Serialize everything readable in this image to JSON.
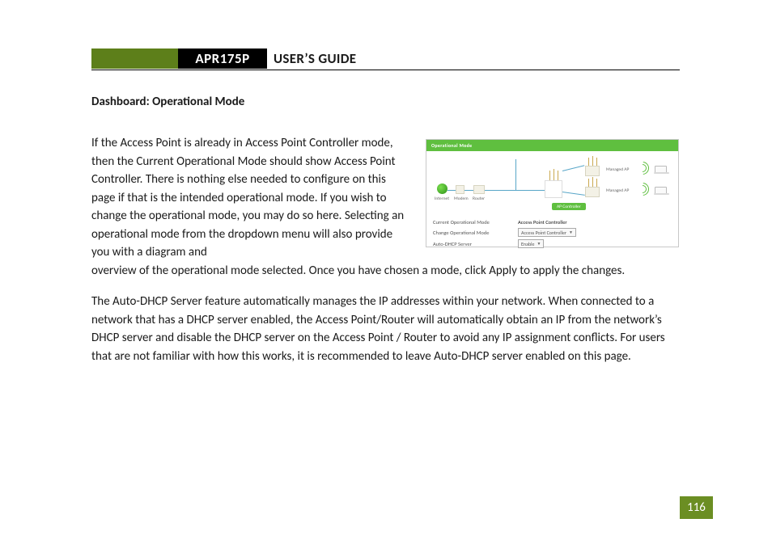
{
  "header": {
    "model": "APR175P",
    "title": "USER’S GUIDE"
  },
  "section_heading": "Dashboard: Operational Mode",
  "para1": "If the Access Point is already in Access Point Controller mode, then the Current Operational Mode should show Access Point Controller.  There is nothing else needed to configure on this page if that is the intended operational mode.  If you wish to change the operational mode, you may do so here.  Selecting an operational mode from the dropdown menu will also provide you with a diagram and",
  "para1_cont": "overview of the operational mode selected.  Once you have chosen a mode, click Apply to apply the changes.",
  "para2": "The Auto-DHCP Server feature automatically manages the IP addresses within your network.  When connected to a network that has a DHCP server enabled, the Access Point/Router will automatically obtain an IP from the network’s DHCP server and disable the DHCP server on the Access Point / Router to avoid any IP assignment conflicts. For users that are not familiar with how this works, it is recommended to leave Auto-DHCP server enabled on this page.",
  "shot": {
    "title": "Operational Mode",
    "labels": {
      "internet": "Internet",
      "modem": "Modem",
      "router": "Router",
      "managed_ap": "Managed AP"
    },
    "button": "AP Controller",
    "fields": {
      "current_label": "Current Operational Mode",
      "current_value": "Access Point Controller",
      "change_label": "Change Operational Mode",
      "change_value": "Access Point Controller",
      "auto_label": "Auto-DHCP Server",
      "auto_value": "Enable"
    }
  },
  "page_number": "116"
}
